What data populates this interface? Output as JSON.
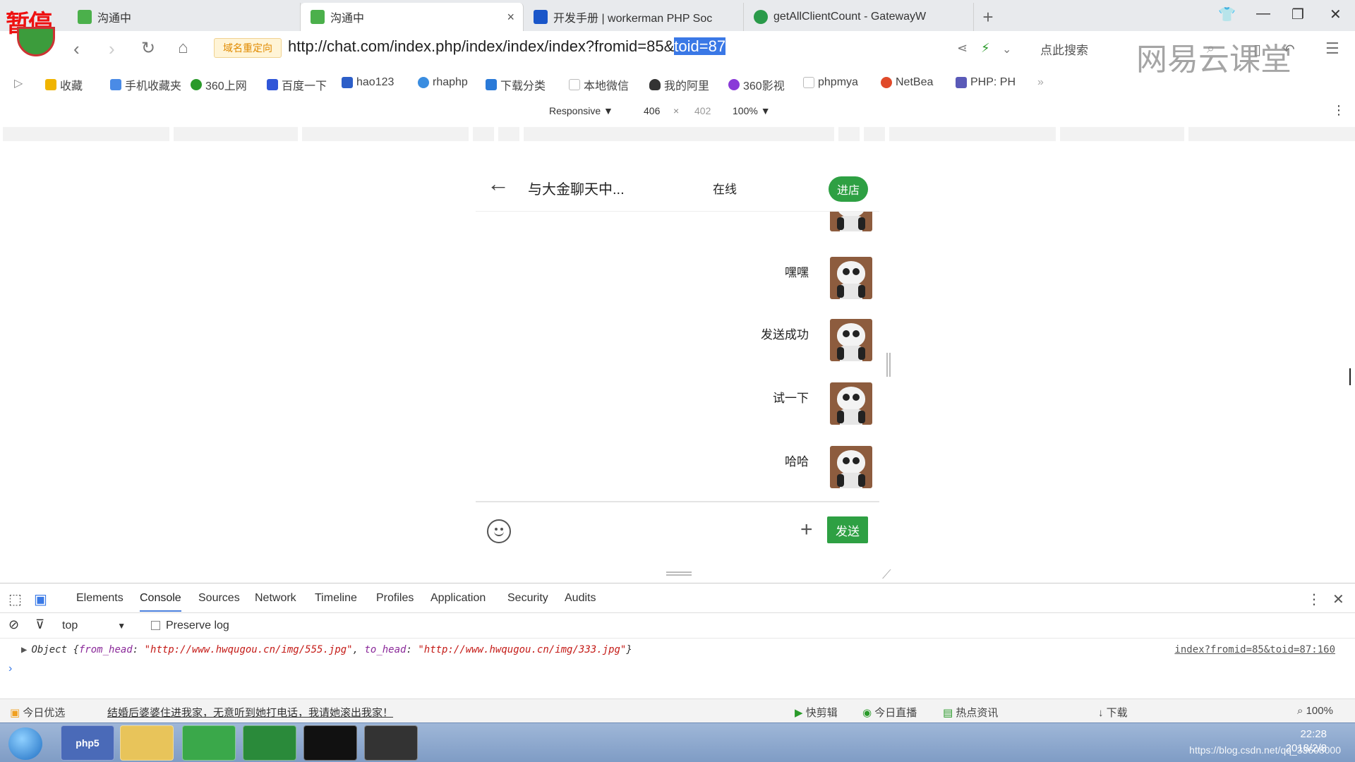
{
  "overlay": {
    "pause_text": "暂停",
    "watermark_logo": "网易云课堂"
  },
  "browser": {
    "tabs": [
      {
        "label": "沟通中",
        "icon": "chat-bubble-icon",
        "color": "#4bb04b"
      },
      {
        "label": "沟通中",
        "icon": "chat-bubble-icon",
        "color": "#4bb04b",
        "active": true
      },
      {
        "label": "开发手册 | workerman PHP Soc",
        "icon": "workerman-icon",
        "color": "#1a56c9"
      },
      {
        "label": "getAllClientCount - GatewayW",
        "icon": "gateway-icon",
        "color": "#2a9a4a"
      }
    ],
    "redirect_badge": "域名重定向",
    "url_main": "http://chat.com/index.php/index/index/index?fromid=85&",
    "url_selected": "toid=87",
    "search_hint": "点此搜索",
    "bookmarks": [
      {
        "label": "收藏",
        "icon": "star-icon",
        "color": "#f0b400"
      },
      {
        "label": "手机收藏夹",
        "icon": "phone-icon",
        "color": "#4a8be6"
      },
      {
        "label": "360上网",
        "icon": "360-icon",
        "color": "#2a9a2a"
      },
      {
        "label": "百度一下",
        "icon": "baidu-paw-icon",
        "color": "#3056d8"
      },
      {
        "label": "hao123",
        "icon": "hao123-icon",
        "color": "#2c5ec8"
      },
      {
        "label": "rhaphp",
        "icon": "rhaphp-icon",
        "color": "#3a8de0"
      },
      {
        "label": "下载分类",
        "icon": "download-category-icon",
        "color": "#2a7ad8"
      },
      {
        "label": "本地微信",
        "icon": "page-icon",
        "color": "#bbbbbb"
      },
      {
        "label": "我的阿里",
        "icon": "penguin-icon",
        "color": "#333333"
      },
      {
        "label": "360影视",
        "icon": "360-video-icon",
        "color": "#8a3ad8"
      },
      {
        "label": "phpmya",
        "icon": "page-icon",
        "color": "#bbbbbb"
      },
      {
        "label": "NetBea",
        "icon": "netbeans-icon",
        "color": "#e04a2a"
      },
      {
        "label": "PHP: PH",
        "icon": "php-icon",
        "color": "#5a5ab8"
      }
    ]
  },
  "device_toolbar": {
    "mode": "Responsive",
    "width": "406",
    "times": "×",
    "height": "402",
    "zoom": "100%"
  },
  "chat": {
    "title": "与大金聊天中...",
    "status": "在线",
    "enter_label": "进店",
    "messages": [
      {
        "text": ""
      },
      {
        "text": "嘿嘿"
      },
      {
        "text": "发送成功"
      },
      {
        "text": "试一下"
      },
      {
        "text": "哈哈"
      }
    ],
    "send_label": "发送",
    "accent": "#2ea043"
  },
  "devtools": {
    "tabs": [
      "Elements",
      "Console",
      "Sources",
      "Network",
      "Timeline",
      "Profiles",
      "Application",
      "Security",
      "Audits"
    ],
    "active_tab": "Console",
    "context": "top",
    "preserve_log": "Preserve log",
    "log_prefix": "Object {",
    "log_key1": "from_head",
    "log_val1": "\"http://www.hwqugou.cn/img/555.jpg\"",
    "log_key2": "to_head",
    "log_val2": "\"http://www.hwqugou.cn/img/333.jpg\"",
    "log_suffix": "}",
    "log_source": "index?fromid=85&toid=87:160"
  },
  "statusbar": {
    "picks": "今日优选",
    "news": "结婚后婆婆住进我家，无意听到她打电话，我请她滚出我家！",
    "items": [
      "快剪辑",
      "今日直播",
      "热点资讯",
      "下载",
      "100%"
    ]
  },
  "taskbar": {
    "apps": [
      "php5",
      "folder",
      "360",
      "wechat",
      "cmd",
      "obs"
    ],
    "time": "22:28",
    "date": "2018/2/8",
    "watermark": "https://blog.csdn.net/qq_33608000"
  }
}
